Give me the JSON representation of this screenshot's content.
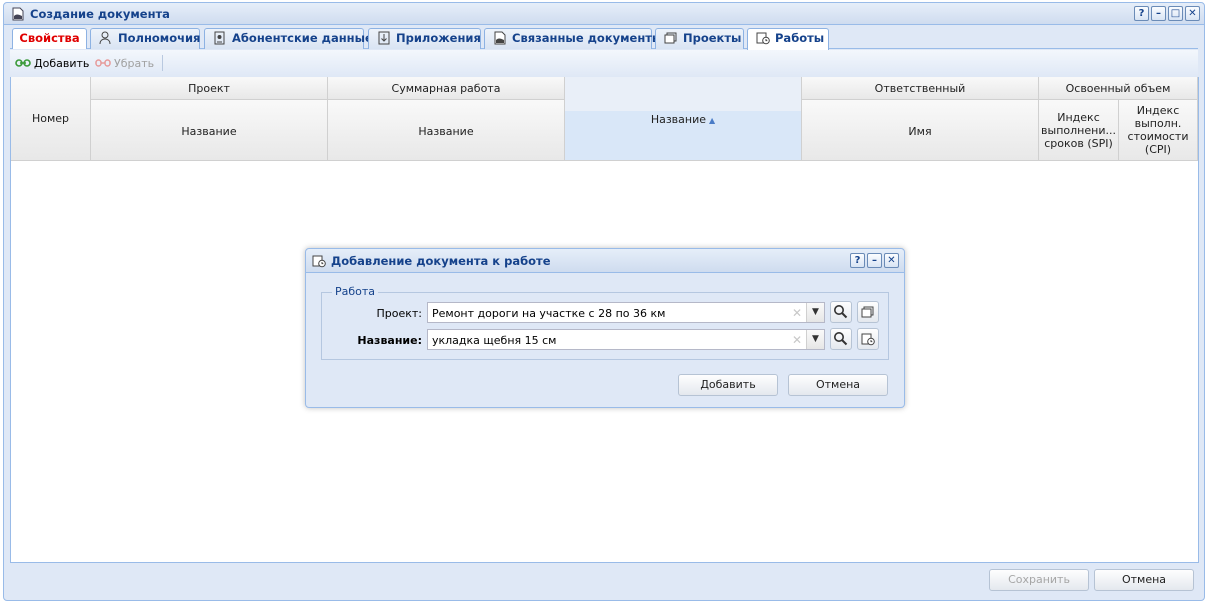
{
  "window": {
    "title": "Создание документа",
    "help": "?",
    "minimize": "–",
    "maximize": "□",
    "close": "✕"
  },
  "tabs": [
    {
      "label": "Свойства",
      "icon": ""
    },
    {
      "label": "Полномочия",
      "icon": "user-key-icon"
    },
    {
      "label": "Абонентские данные",
      "icon": "contact-card-icon"
    },
    {
      "label": "Приложения",
      "icon": "attachment-download-icon"
    },
    {
      "label": "Связанные документы",
      "icon": "linked-docs-icon"
    },
    {
      "label": "Проекты",
      "icon": "projects-icon"
    },
    {
      "label": "Работы",
      "icon": "tasks-clock-icon"
    }
  ],
  "toolbar": {
    "add_label": "Добавить",
    "remove_label": "Убрать"
  },
  "grid": {
    "col_number": "Номер",
    "group_project": "Проект",
    "group_summary": "Суммарная работа",
    "group_responsible": "Ответственный",
    "group_earned": "Освоенный объем",
    "project_name": "Название",
    "summary_name": "Название",
    "work_name": "Название",
    "sort_indicator": "▲",
    "responsible_name": "Имя",
    "spi_label": "Индекс выполнени... сроков (SPI)",
    "cpi_label": "Индекс выполн. стоимости (CPI)"
  },
  "footer": {
    "save_label": "Сохранить",
    "cancel_label": "Отмена"
  },
  "dialog": {
    "title": "Добавление документа к работе",
    "fieldset_legend": "Работа",
    "project_label": "Проект:",
    "project_value": "Ремонт дороги на участке с 28 по 36 км",
    "name_label": "Название:",
    "name_value": "укладка щебня 15 см",
    "add_label": "Добавить",
    "cancel_label": "Отмена"
  },
  "colors": {
    "accent": "#15428b",
    "active_tab_text": "#e00000",
    "panel_bg": "#dfe8f6",
    "border": "#99bbe8"
  }
}
